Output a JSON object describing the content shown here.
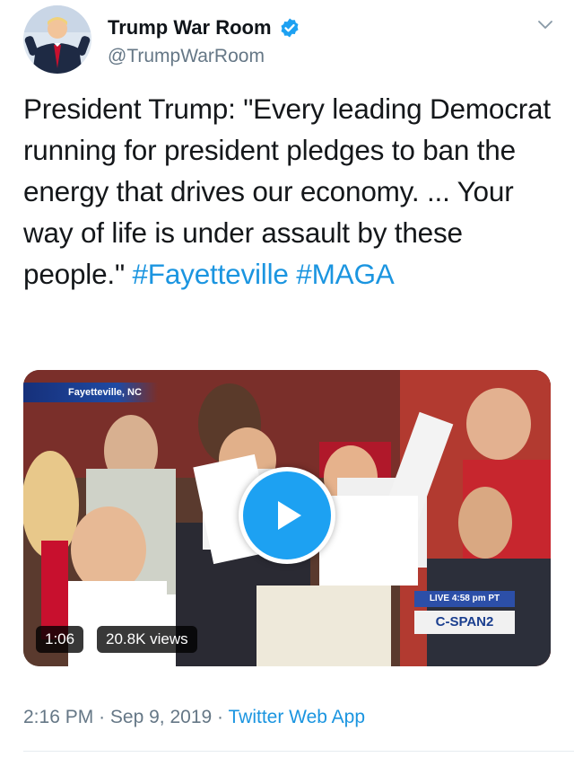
{
  "author": {
    "display_name": "Trump War Room",
    "handle": "@TrumpWarRoom",
    "verified": true,
    "avatar_icon": "profile-photo",
    "verified_icon": "verified-badge-icon"
  },
  "tweet": {
    "text": "President Trump: \"Every leading Democrat running for president pledges to ban the energy that drives our economy. ... Your way of life is under assault by these people.\" ",
    "hashtags": [
      "#Fayetteville",
      "#MAGA"
    ]
  },
  "video": {
    "location_label": "Fayetteville, NC",
    "live_label": "LIVE  4:58 pm PT",
    "network_label": "C-SPAN2",
    "duration": "1:06",
    "views": "20.8K views",
    "play_icon": "play-icon"
  },
  "meta": {
    "time": "2:16 PM",
    "separator": "·",
    "date": "Sep 9, 2019",
    "source": "Twitter Web App"
  },
  "colors": {
    "accent": "#1da1f2",
    "link": "#1b95e0",
    "secondary_text": "#657786"
  }
}
